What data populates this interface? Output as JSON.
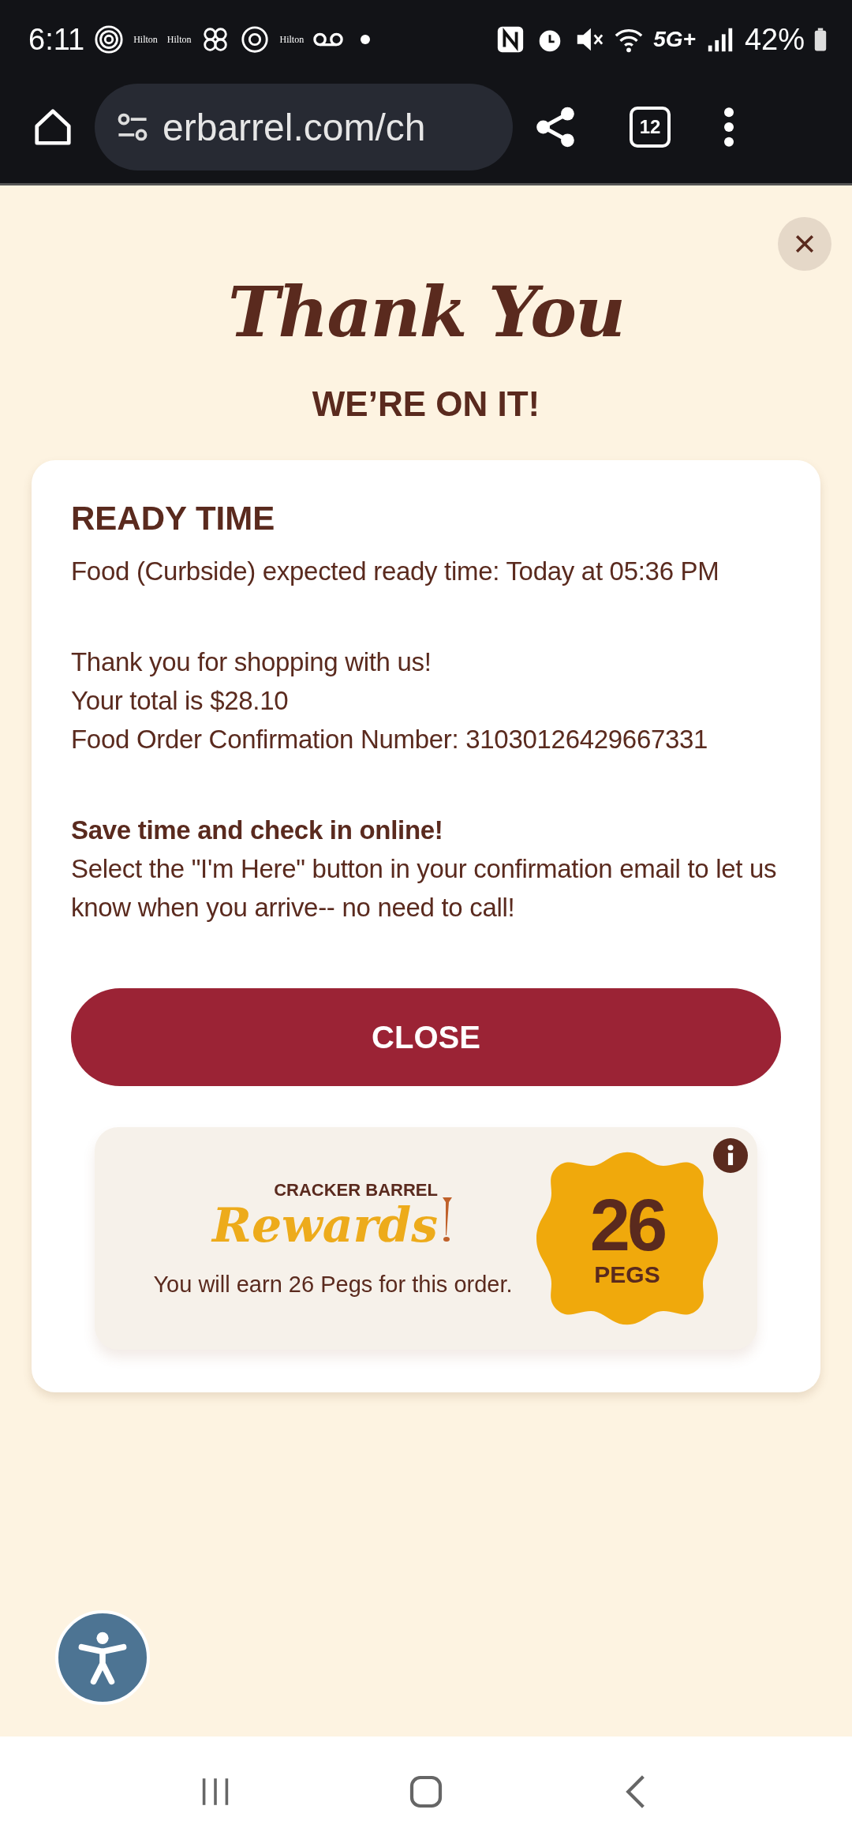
{
  "status_bar": {
    "time": "6:11",
    "notification_labels": [
      "Hilton",
      "Hilton",
      "Hilton"
    ],
    "battery": "42%",
    "network": "5G+"
  },
  "browser": {
    "url": "erbarrel.com/ch",
    "tab_count": "12"
  },
  "header": {
    "title": "Thank You",
    "subtitle": "WE’RE ON IT!"
  },
  "order": {
    "heading": "READY TIME",
    "ready_time": "Food (Curbside) expected ready time: Today at 05:36 PM",
    "thanks_lines": [
      "Thank you for shopping with us!",
      "Your total is $28.10",
      "Food Order Confirmation Number: 31030126429667331"
    ],
    "checkin_heading": "Save time and check in online!",
    "checkin_text": "Select the \"I'm Here\" button in your confirmation email to let us know when you arrive-- no need to call!",
    "close_button": "CLOSE"
  },
  "rewards": {
    "brand": "CRACKER BARREL",
    "logo_word": "Rewards",
    "message": "You will earn 26 Pegs for this order.",
    "pegs": "26",
    "pegs_label": "PEGS"
  }
}
